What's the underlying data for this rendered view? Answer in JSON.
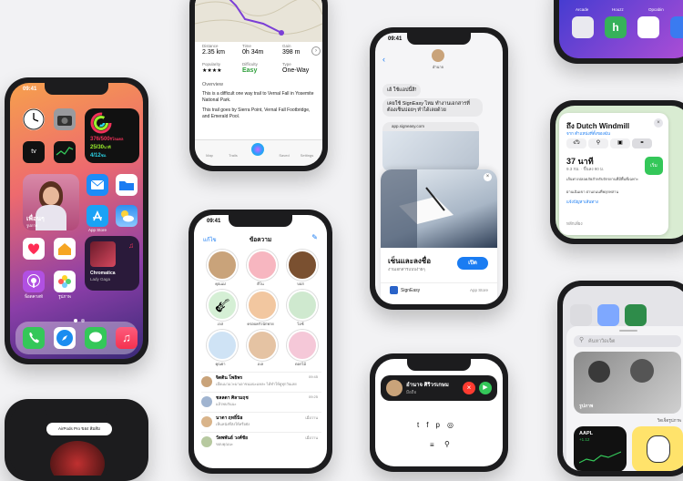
{
  "status": {
    "time": "09:41"
  },
  "home": {
    "fitness": {
      "move": "376/500",
      "move_unit": "กิโลแคล",
      "exercise": "25/30",
      "exercise_unit": "นาที",
      "stand": "4/12",
      "stand_unit": "ชม."
    },
    "photo_label": "เพื่อนๆ",
    "photo_sub": "รูปภาพ",
    "music": {
      "title": "Chromatica",
      "artist": "Lady Gaga"
    },
    "apps": [
      "Mail",
      "Files",
      "App Store",
      "Weather",
      "Health",
      "Home",
      "Music",
      "Podcasts",
      "Photos"
    ],
    "app_labels": {
      "appstore": "App Store",
      "podcasts": "พ็อดคาสท์",
      "photos": "รูปภาพ"
    },
    "dock": [
      "Phone",
      "Safari",
      "Messages",
      "Music"
    ],
    "page_dots": 2
  },
  "maps_trail": {
    "distance": {
      "label": "Distance",
      "value": "2.35 km"
    },
    "time": {
      "label": "Time",
      "value": "0h 34m"
    },
    "gain": {
      "label": "Gain",
      "value": "398 m"
    },
    "popularity": {
      "label": "Popularity",
      "value": "★★★★"
    },
    "difficulty": {
      "label": "Difficulty",
      "value": "Easy"
    },
    "type": {
      "label": "Type",
      "value": "One-Way"
    },
    "overview_title": "Overview",
    "overview_text": "This is a difficult one way trail to Vernal Fall in Yosemite National Park.",
    "overview_text2": "This trail goes by Sierra Point, Vernal Fall Footbridge, and Emerald Pool.",
    "tabs": [
      "Map",
      "Trails",
      "Saved",
      "Settings"
    ]
  },
  "chat_clip": {
    "contact": "อำนาจ",
    "bubble1": "เฮ้ ใช้แอปนี้สิ!",
    "bubble2": "เคยใช้ SignEasy ไหม ทำงานเอกสารที่ต้องเซ็นบ่อยๆ ทำได้เลยด้วย",
    "link": "app.signeasy.com",
    "clip_title": "เซ็นและลงชื่อ",
    "clip_sub": "งานเอกสารแบบง่ายๆ",
    "clip_button": "เปิด",
    "app_name": "SignEasy",
    "app_store": "App Store"
  },
  "maps_directions": {
    "title": "ถึง Dutch Windmill",
    "from": "จาก ตำแหน่งที่ตั้งของฉัน",
    "duration": "37 นาที",
    "meta": "9.3 กม. · ขึ้นลง 90 ม.",
    "go_button": "เริ่ม",
    "note1": "เส้นทางปลอดภัยสำหรับจักรยานที่มีพื้นที่เฉพาะ",
    "note2": "ผ่านเนินเขา ผ่านถนนที่พลุกพล่าน",
    "report": "แจ้งปัญหาเส้นทาง",
    "more": "หลีกเลี่ยง"
  },
  "messages": {
    "edit": "แก้ไข",
    "title": "ข้อความ",
    "pinned": [
      "คุณแม่",
      "ดีโน",
      "บอส",
      "เจส",
      "ครอบครัวนักพาย",
      "ไอซ์",
      "คุณย่า",
      "เบล",
      "ดอกไม้"
    ],
    "conversations": [
      {
        "name": "จิตติน โพธิพร",
        "time": "09:45",
        "preview": "เมื่อแมวแวะมาเอาขนมน่ะแหละ ได้ทำให้ดูทุกวันเลย"
      },
      {
        "name": "ชลลดา ศิลามฤช",
        "time": "09:25",
        "preview": "แล้วพบกันนะ"
      },
      {
        "name": "นาตา ฤทธิ์นิธ",
        "time": "เมื่อวาน",
        "preview": "เห็นหนังที่ส่งให้หรือยัง"
      },
      {
        "name": "วัลพพันธ์ วงศ์ชัย",
        "time": "เมื่อวาน",
        "preview": "ขอบคุณนะ"
      }
    ]
  },
  "call": {
    "name": "อำนาจ ศิริวรเกษม",
    "sub": "มือถือ",
    "social": [
      "t",
      "f",
      "p",
      "◎",
      ""
    ]
  },
  "widgets": {
    "search": "ค้นหาวิดเจ็ต",
    "photo_label": "รูปภาพ",
    "stock": {
      "symbol": "AAPL",
      "price": "123.41",
      "change": "+1.12"
    },
    "widget_caption": "วิดเจ็ตรูปภาพ"
  },
  "airpods": {
    "text": "AirPods Pro ของ ส้มส้ม"
  },
  "partial_apps": {
    "labels": [
      "Arcade",
      "Houzz",
      "Opcabin"
    ]
  }
}
